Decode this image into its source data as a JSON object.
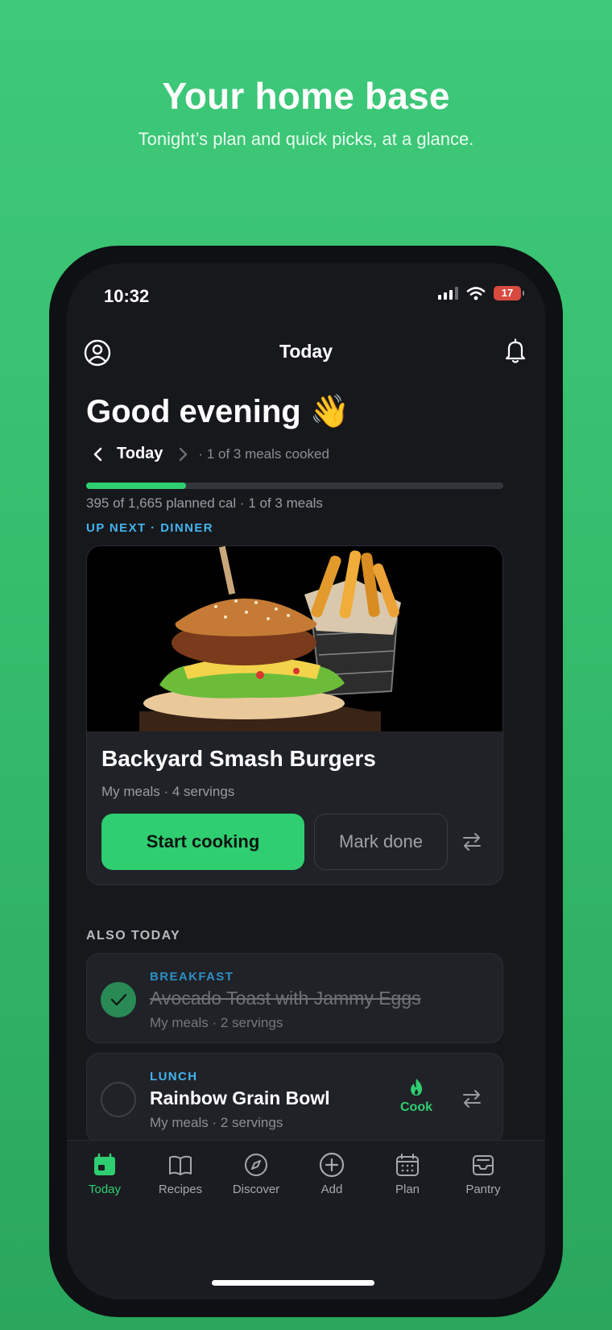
{
  "promo": {
    "title": "Your home base",
    "subtitle": "Tonight’s plan and quick picks, at a glance."
  },
  "status_bar": {
    "time": "10:32",
    "battery": "17"
  },
  "topbar": {
    "title": "Today",
    "left_icon": "profile-icon",
    "right_icon": "bell-icon"
  },
  "greeting": "Good evening 👋",
  "date_nav": {
    "label": "Today",
    "meta": "· 1 of 3 meals cooked"
  },
  "progress": {
    "fraction": 0.24,
    "text": "395 of 1,665 planned cal · 1 of 3 meals"
  },
  "up_next": {
    "label": "UP NEXT · DINNER",
    "name": "Backyard Smash Burgers",
    "meta": "My meals · 4 servings",
    "primary_button": "Start cooking",
    "secondary_button": "Mark done"
  },
  "also_today": {
    "label": "ALSO TODAY",
    "items": [
      {
        "type": "BREAKFAST",
        "name": "Avocado Toast with Jammy Eggs",
        "meta": "My meals · 2 servings",
        "done": true
      },
      {
        "type": "LUNCH",
        "name": "Rainbow Grain Bowl",
        "meta": "My meals · 2 servings",
        "done": false,
        "action": "Cook"
      }
    ]
  },
  "tabs": [
    {
      "label": "Today",
      "icon": "calendar-today-icon",
      "active": true
    },
    {
      "label": "Recipes",
      "icon": "book-icon",
      "active": false
    },
    {
      "label": "Discover",
      "icon": "compass-icon",
      "active": false
    },
    {
      "label": "Add",
      "icon": "plus-circle-icon",
      "active": false
    },
    {
      "label": "Plan",
      "icon": "calendar-grid-icon",
      "active": false
    },
    {
      "label": "Pantry",
      "icon": "tray-icon",
      "active": false
    }
  ],
  "colors": {
    "accent": "#2fce70",
    "info": "#42b4ef",
    "background": "#17181c",
    "card": "#202228"
  }
}
